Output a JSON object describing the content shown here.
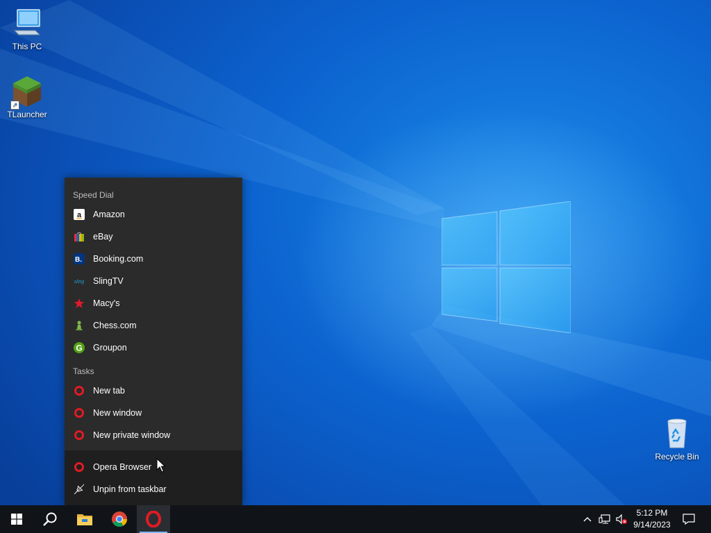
{
  "desktop": {
    "icons": [
      {
        "label": "This PC"
      },
      {
        "label": "TLauncher"
      },
      {
        "label": "Recycle Bin"
      }
    ]
  },
  "jumplist": {
    "speed_dial_header": "Speed Dial",
    "speed_dial": [
      {
        "label": "Amazon",
        "icon": "amazon-icon"
      },
      {
        "label": "eBay",
        "icon": "ebay-icon"
      },
      {
        "label": "Booking.com",
        "icon": "booking-icon"
      },
      {
        "label": "SlingTV",
        "icon": "slingtv-icon"
      },
      {
        "label": "Macy's",
        "icon": "macys-icon"
      },
      {
        "label": "Chess.com",
        "icon": "chess-icon"
      },
      {
        "label": "Groupon",
        "icon": "groupon-icon"
      }
    ],
    "tasks_header": "Tasks",
    "tasks": [
      {
        "label": "New tab",
        "icon": "opera-icon"
      },
      {
        "label": "New window",
        "icon": "opera-icon"
      },
      {
        "label": "New private window",
        "icon": "opera-icon"
      }
    ],
    "app_label": "Opera Browser",
    "unpin_label": "Unpin from taskbar"
  },
  "taskbar": {
    "pinned": [
      "start-icon",
      "search-icon",
      "file-explorer-icon",
      "chrome-icon",
      "opera-icon"
    ],
    "clock_time": "5:12 PM",
    "clock_date": "9/14/2023"
  },
  "colors": {
    "taskbar": "#101419",
    "jumplist": "#2b2b2b",
    "opera_red": "#e01b24",
    "accent": "#7db8ff"
  }
}
